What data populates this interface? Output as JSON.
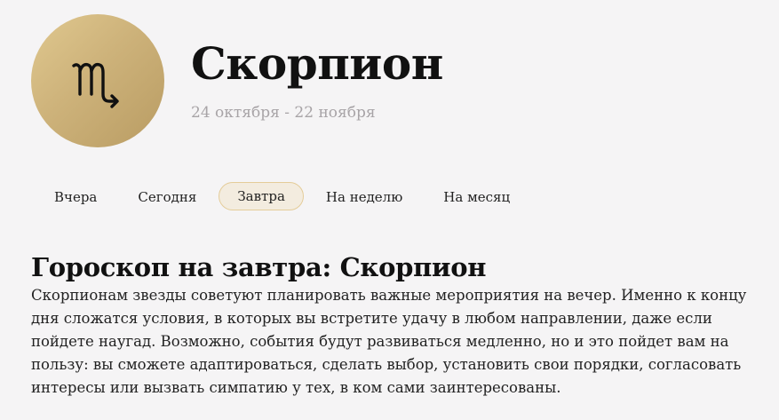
{
  "header": {
    "sign_icon": "scorpio-icon",
    "title": "Скорпион",
    "dates": "24 октября - 22 ноября"
  },
  "tabs": [
    {
      "label": "Вчера",
      "active": false
    },
    {
      "label": "Сегодня",
      "active": false
    },
    {
      "label": "Завтра",
      "active": true
    },
    {
      "label": "На неделю",
      "active": false
    },
    {
      "label": "На месяц",
      "active": false
    }
  ],
  "article": {
    "heading": "Гороскоп на завтра: Скорпион",
    "text": "Скорпионам звезды советуют планировать важные мероприятия на вечер. Именно к концу дня сложатся условия, в которых вы встретите удачу в любом направлении, даже если пойдете наугад. Возможно, события будут развиваться медленно, но и это пойдет вам на пользу: вы сможете адаптироваться, сделать выбор, установить свои порядки, согласовать интересы или вызвать симпатию у тех, в ком сами заинтересованы."
  },
  "colors": {
    "accent_gold": "#cdb27a",
    "active_tab_bg": "#f3ecdf",
    "active_tab_border": "#e4cc99",
    "muted_text": "#a8a4a7"
  }
}
